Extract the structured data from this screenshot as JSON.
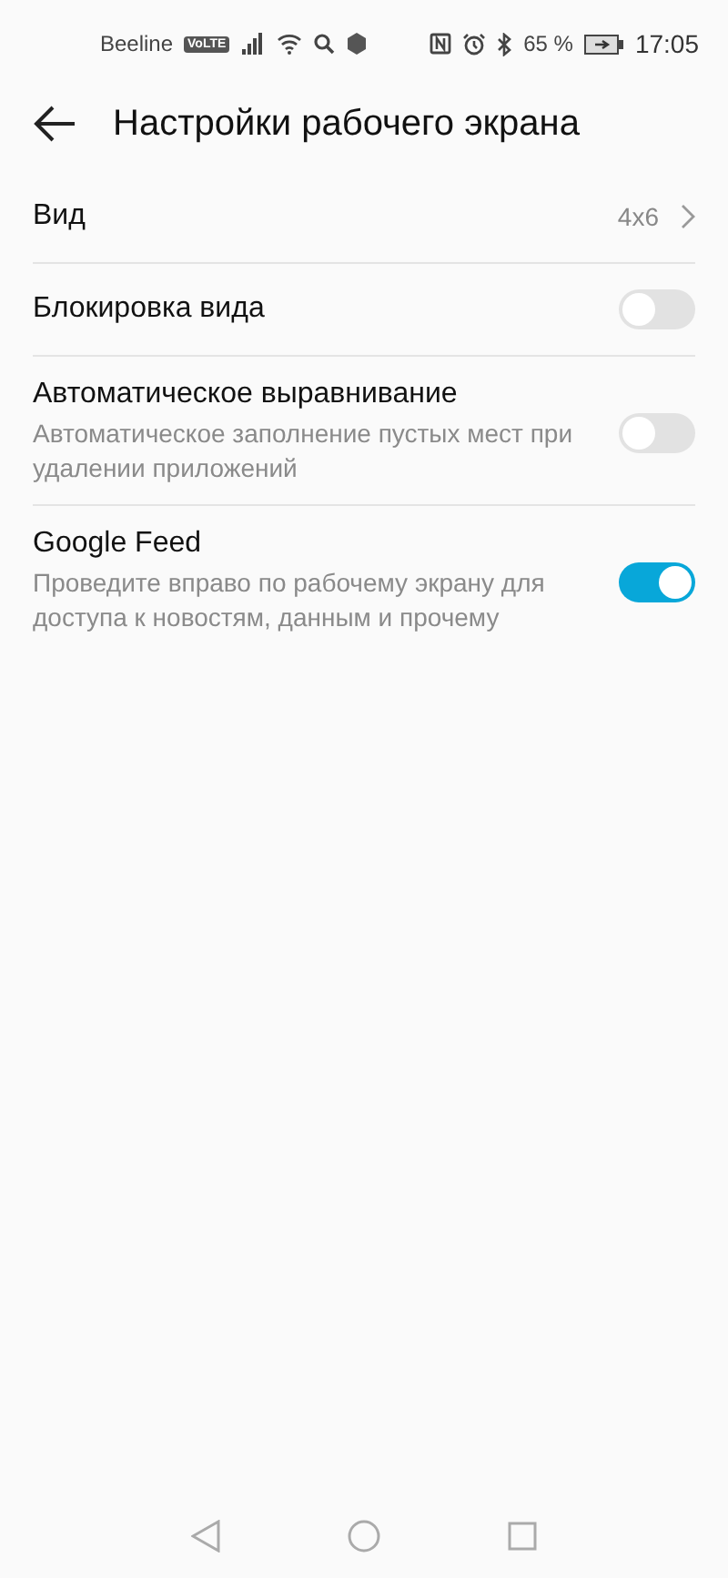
{
  "status_bar": {
    "carrier": "Beeline",
    "network_badge": "VoLTE",
    "battery": "65 %",
    "time": "17:05"
  },
  "header": {
    "title": "Настройки рабочего экрана"
  },
  "settings": [
    {
      "kind": "link",
      "title": "Вид",
      "value": "4x6"
    },
    {
      "kind": "toggle",
      "title": "Блокировка вида",
      "on": false
    },
    {
      "kind": "toggle",
      "title": "Автоматическое выравнивание",
      "subtitle": "Автоматическое заполнение пустых мест при удалении приложений",
      "on": false
    },
    {
      "kind": "toggle",
      "title": "Google Feed",
      "subtitle": "Проведите вправо по рабочему экрану для доступа к новостям, данным и прочему",
      "on": true
    }
  ]
}
